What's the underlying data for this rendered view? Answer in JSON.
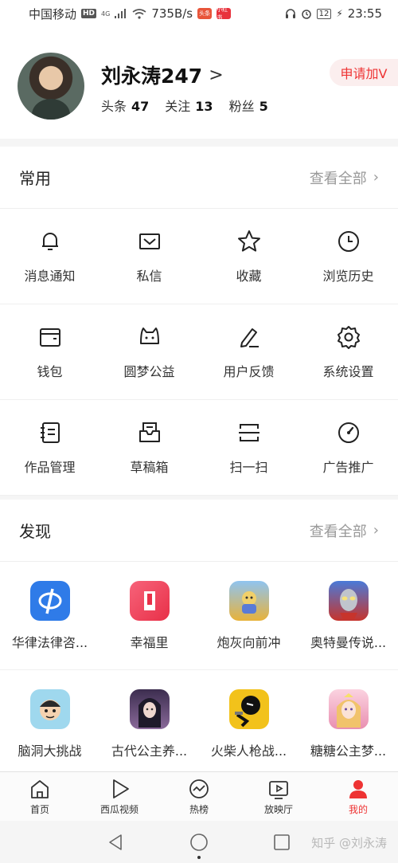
{
  "statusbar": {
    "carrier": "中国移动",
    "hd": "HD",
    "net": "4G",
    "speed": "735B/s",
    "app1": "头条",
    "app2": "小红书",
    "battery": "12",
    "time": "23:55"
  },
  "profile": {
    "name": "刘永涛247",
    "chevron": ">",
    "stats": [
      {
        "label": "头条",
        "value": "47"
      },
      {
        "label": "关注",
        "value": "13"
      },
      {
        "label": "粉丝",
        "value": "5"
      }
    ],
    "v_button": "申请加V"
  },
  "common": {
    "title": "常用",
    "more": "查看全部",
    "items": [
      {
        "label": "消息通知",
        "icon": "bell-icon"
      },
      {
        "label": "私信",
        "icon": "mail-icon"
      },
      {
        "label": "收藏",
        "icon": "star-icon"
      },
      {
        "label": "浏览历史",
        "icon": "clock-icon"
      },
      {
        "label": "钱包",
        "icon": "wallet-icon"
      },
      {
        "label": "圆梦公益",
        "icon": "cat-face-icon"
      },
      {
        "label": "用户反馈",
        "icon": "pen-icon"
      },
      {
        "label": "系统设置",
        "icon": "gear-icon"
      },
      {
        "label": "作品管理",
        "icon": "notebook-icon"
      },
      {
        "label": "草稿箱",
        "icon": "drafts-icon"
      },
      {
        "label": "扫一扫",
        "icon": "scan-icon"
      },
      {
        "label": "广告推广",
        "icon": "gauge-icon"
      }
    ]
  },
  "discover": {
    "title": "发现",
    "more": "查看全部",
    "items": [
      {
        "label": "华律法律咨...",
        "icon": "hualv-app-icon",
        "color": "#2f7be8"
      },
      {
        "label": "幸福里",
        "icon": "xingfuli-app-icon",
        "color": "#f0455a"
      },
      {
        "label": "炮灰向前冲",
        "icon": "paohui-game-icon",
        "color": "#e8b23a"
      },
      {
        "label": "奥特曼传说...",
        "icon": "ultraman-game-icon",
        "color": "#c7342c"
      },
      {
        "label": "脑洞大挑战",
        "icon": "naodong-game-icon",
        "color": "#7cc8e8"
      },
      {
        "label": "古代公主养...",
        "icon": "princess-game-icon",
        "color": "#6b4a7a"
      },
      {
        "label": "火柴人枪战...",
        "icon": "stickman-game-icon",
        "color": "#f2c21b"
      },
      {
        "label": "糖糖公主梦...",
        "icon": "tangtang-game-icon",
        "color": "#f3b3c6"
      }
    ]
  },
  "tabbar": {
    "tabs": [
      {
        "label": "首页",
        "icon": "home-icon"
      },
      {
        "label": "西瓜视频",
        "icon": "play-icon"
      },
      {
        "label": "热榜",
        "icon": "trend-icon"
      },
      {
        "label": "放映厅",
        "icon": "tv-icon"
      },
      {
        "label": "我的",
        "icon": "person-icon"
      }
    ],
    "active_color": "#e33333"
  },
  "watermark": "知乎 @刘永涛"
}
